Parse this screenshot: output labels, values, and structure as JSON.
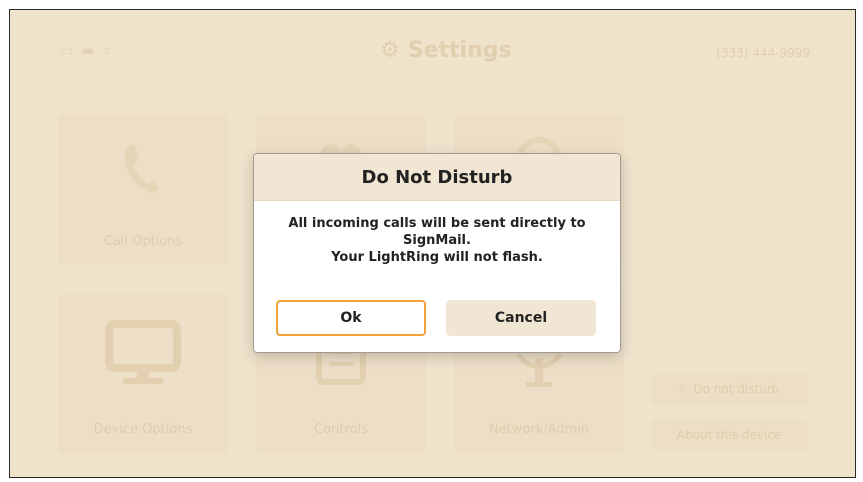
{
  "header": {
    "title": "Settings",
    "phone_number": "(333) 444-9999"
  },
  "tiles": [
    {
      "label": "Call Options"
    },
    {
      "label": ""
    },
    {
      "label": ""
    },
    {
      "label": "Device Options"
    },
    {
      "label": "Controls"
    },
    {
      "label": "Network/Admin"
    }
  ],
  "side_buttons": {
    "do_not_disturb": "Do not disturb",
    "about": "About this device"
  },
  "dialog": {
    "title": "Do Not Disturb",
    "line1": "All incoming calls will be sent directly to",
    "line2": "SignMail.",
    "line3": "Your LightRing will not flash.",
    "ok": "Ok",
    "cancel": "Cancel"
  },
  "colors": {
    "background": "#efe3cc",
    "accent_focus": "#f0a33a"
  },
  "icons": [
    "monitor-icon",
    "camera-icon",
    "mic-icon",
    "gear-icon",
    "phone-icon",
    "monitor-icon",
    "keypad-icon",
    "antenna-icon",
    "moon-icon"
  ]
}
